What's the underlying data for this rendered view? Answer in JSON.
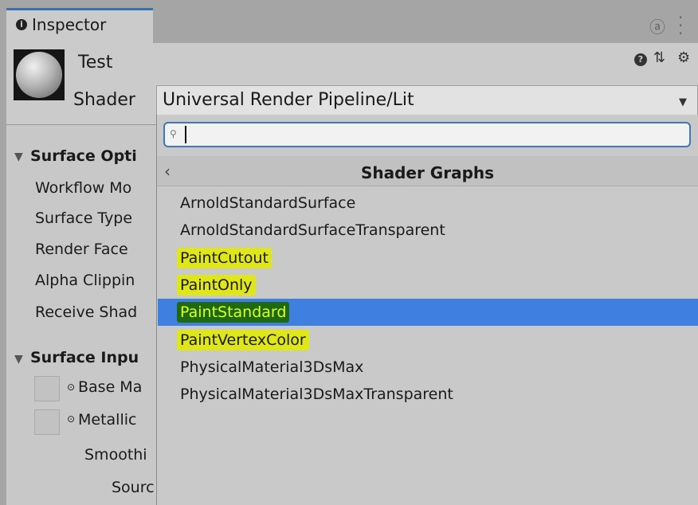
{
  "window": {
    "tab_title": "Inspector",
    "info_icon": "i",
    "lock_icon": "lock-icon",
    "menu_icon": "kebab-menu-icon"
  },
  "material": {
    "name": "Test",
    "help_icon": "?",
    "shader_label": "Shader",
    "shader_value": "Universal Render Pipeline/Lit"
  },
  "left_panel": {
    "surface_options": "Surface Opti",
    "rows": [
      "Workflow Mo",
      "Surface Type",
      "Render Face",
      "Alpha Clippin",
      "Receive Shad"
    ],
    "surface_inputs": "Surface Inpu",
    "base_map": "Base Ma",
    "metallic": "Metallic",
    "smoothness": "Smoothi",
    "source": "Sourc"
  },
  "popup": {
    "search_value": "",
    "title": "Shader Graphs",
    "items": [
      {
        "label": "ArnoldStandardSurface",
        "highlighted": false,
        "selected": false
      },
      {
        "label": "ArnoldStandardSurfaceTransparent",
        "highlighted": false,
        "selected": false
      },
      {
        "label": "PaintCutout",
        "highlighted": true,
        "selected": false
      },
      {
        "label": "PaintOnly",
        "highlighted": true,
        "selected": false
      },
      {
        "label": "PaintStandard",
        "highlighted": true,
        "selected": true
      },
      {
        "label": "PaintVertexColor",
        "highlighted": true,
        "selected": false
      },
      {
        "label": "PhysicalMaterial3DsMax",
        "highlighted": false,
        "selected": false
      },
      {
        "label": "PhysicalMaterial3DsMaxTransparent",
        "highlighted": false,
        "selected": false
      }
    ],
    "selection_color": "#3f7fe0",
    "highlight_color": "#dfe61a"
  }
}
